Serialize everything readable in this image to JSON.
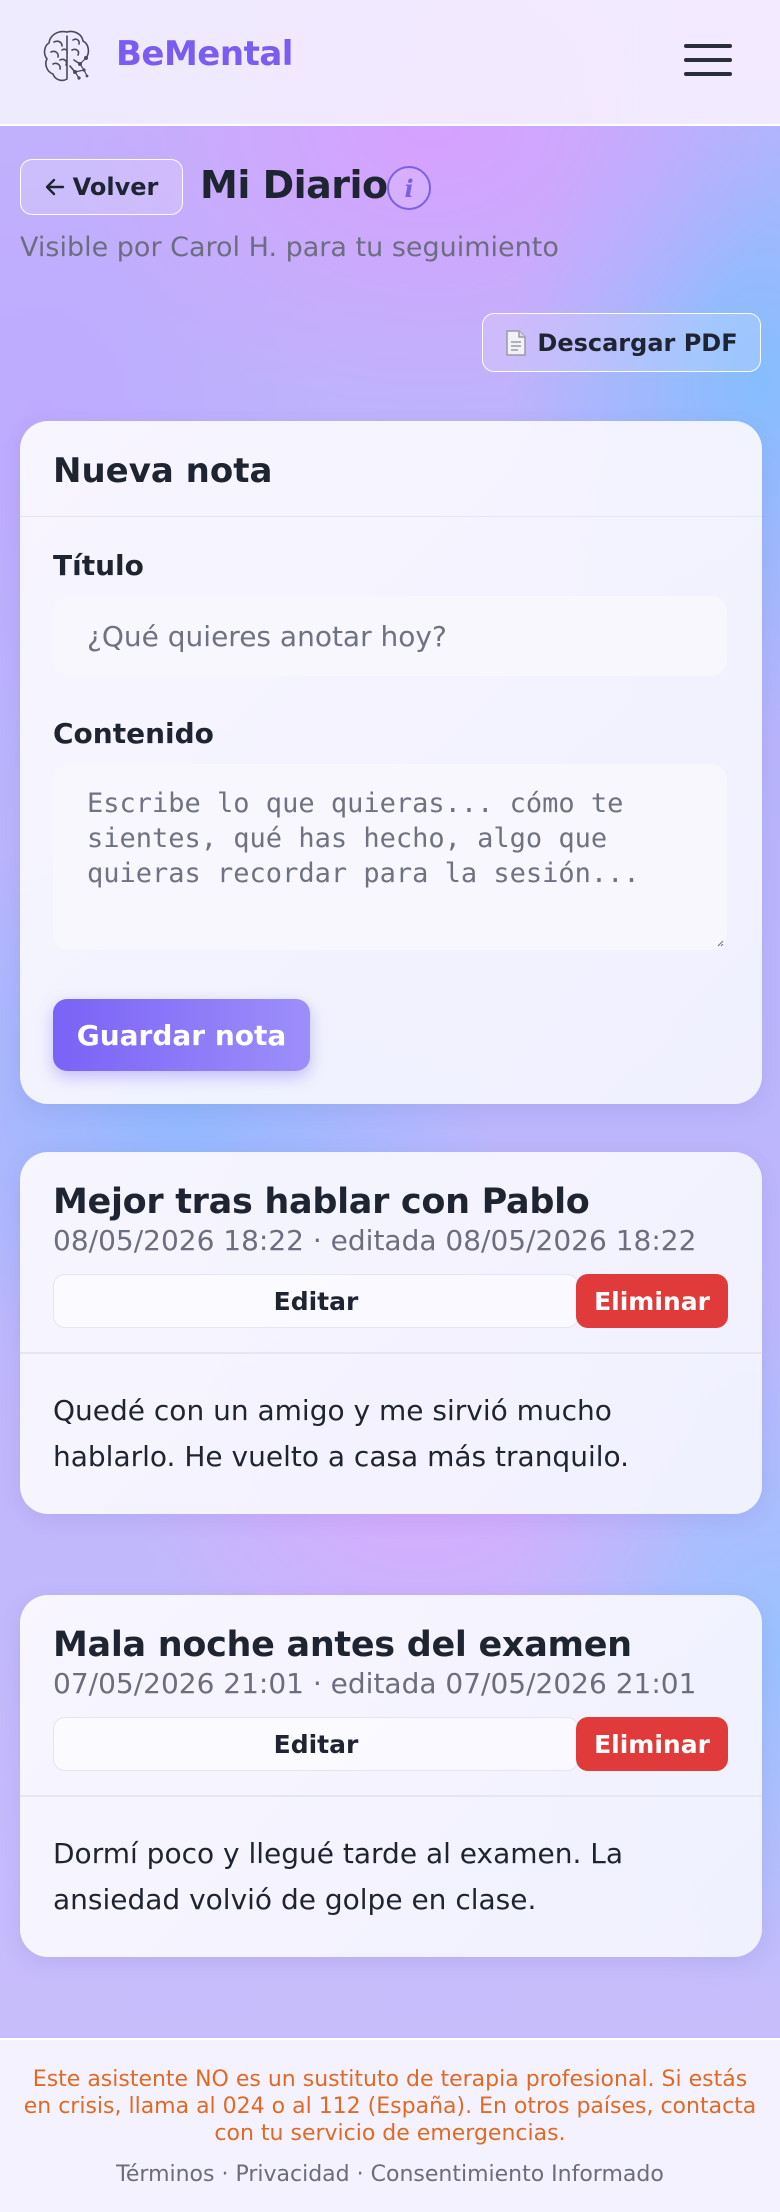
{
  "header": {
    "brand": "BeMental",
    "logo_icon": "brain-icon",
    "menu_icon": "hamburger-menu-icon"
  },
  "page": {
    "back_label": "Volver",
    "back_icon": "arrow-left-icon",
    "title": "Mi Diario",
    "info_label": "i",
    "visible_text": "Visible por Carol H. para tu seguimiento",
    "pdf_label": "Descargar PDF",
    "pdf_icon": "document-icon"
  },
  "new_note": {
    "heading": "Nueva nota",
    "title_label": "Título",
    "title_placeholder": "¿Qué quieres anotar hoy?",
    "content_label": "Contenido",
    "content_placeholder": "Escribe lo que quieras... cómo te sientes, qué has hecho, algo que quieras recordar para la sesión...",
    "save_label": "Guardar nota"
  },
  "entries": [
    {
      "title": "Mejor tras hablar con Pablo",
      "date": "08/05/2026 18:22 · editada 08/05/2026 18:22",
      "edit_label": "Editar",
      "delete_label": "Eliminar",
      "body": "Quedé con un amigo y me sirvió mucho hablarlo. He vuelto a casa más tranquilo."
    },
    {
      "title": "Mala noche antes del examen",
      "date": "07/05/2026 21:01 · editada 07/05/2026 21:01",
      "edit_label": "Editar",
      "delete_label": "Eliminar",
      "body": "Dormí poco y llegué tarde al examen. La ansiedad volvió de golpe en clase."
    }
  ],
  "footer": {
    "disclaimer": "Este asistente NO es un sustituto de terapia profesional. Si estás en crisis, llama al 024 o al 112 (España). En otros países, contacta con tu servicio de emergencias.",
    "links": [
      "Términos",
      "Privacidad",
      "Consentimiento Informado"
    ],
    "separator": " · "
  },
  "colors": {
    "brand": "#7a5cf0",
    "primary_button": "#7a62f6",
    "danger": "#e03a3a",
    "warning_text": "#e06a24"
  }
}
